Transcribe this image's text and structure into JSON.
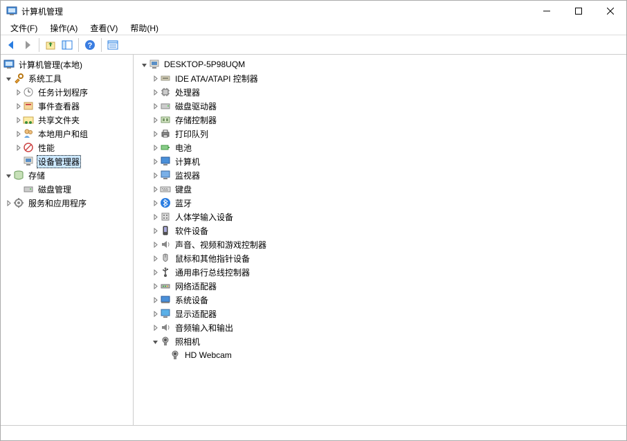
{
  "window": {
    "title": "计算机管理"
  },
  "menu": {
    "file": "文件(F)",
    "action": "操作(A)",
    "view": "查看(V)",
    "help": "帮助(H)"
  },
  "sidebar": {
    "root": "计算机管理(本地)",
    "system_tools": "系统工具",
    "task_scheduler": "任务计划程序",
    "event_viewer": "事件查看器",
    "shared_folders": "共享文件夹",
    "local_users": "本地用户和组",
    "performance": "性能",
    "device_manager": "设备管理器",
    "storage": "存储",
    "disk_management": "磁盘管理",
    "services": "服务和应用程序"
  },
  "devices": {
    "computer_name": "DESKTOP-5P98UQM",
    "ide": "IDE ATA/ATAPI 控制器",
    "processor": "处理器",
    "disk_drives": "磁盘驱动器",
    "storage_controllers": "存储控制器",
    "print_queues": "打印队列",
    "batteries": "电池",
    "computer": "计算机",
    "monitors": "监视器",
    "keyboards": "键盘",
    "bluetooth": "蓝牙",
    "hid": "人体学输入设备",
    "software_devices": "软件设备",
    "sound": "声音、视频和游戏控制器",
    "mice": "鼠标和其他指针设备",
    "usb": "通用串行总线控制器",
    "network": "网络适配器",
    "system_devices": "系统设备",
    "display_adapters": "显示适配器",
    "audio_io": "音频输入和输出",
    "cameras": "照相机",
    "webcam": "HD Webcam"
  }
}
